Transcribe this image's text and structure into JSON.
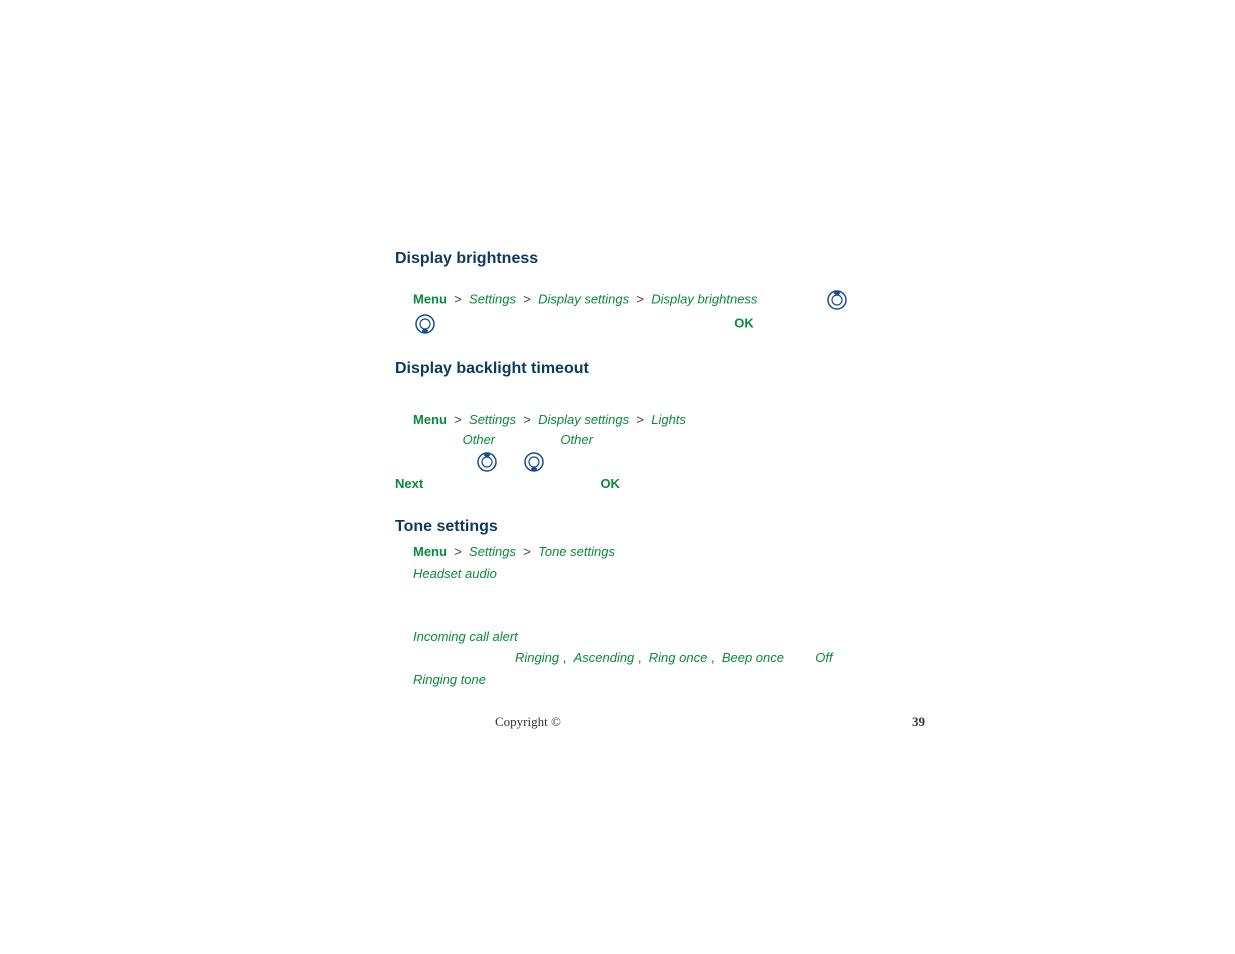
{
  "headings": {
    "display_brightness": "Display brightness",
    "display_backlight_timeout": "Display backlight timeout",
    "tone_settings": "Tone settings"
  },
  "labels": {
    "menu": "Menu",
    "ok": "OK",
    "next": "Next"
  },
  "paths": {
    "settings": "Settings",
    "display_settings": "Display settings",
    "display_brightness": "Display brightness",
    "lights": "Lights",
    "other": "Other",
    "tone_settings": "Tone settings"
  },
  "tone": {
    "headset_audio": "Headset audio",
    "incoming_call_alert": "Incoming call alert",
    "options": {
      "ringing": "Ringing",
      "ascending": "Ascending",
      "ring_once": "Ring once",
      "beep_once": "Beep once",
      "off": "Off"
    },
    "ringing_tone": "Ringing tone"
  },
  "footer": {
    "copyright": "Copyright ©",
    "page_number": "39"
  }
}
